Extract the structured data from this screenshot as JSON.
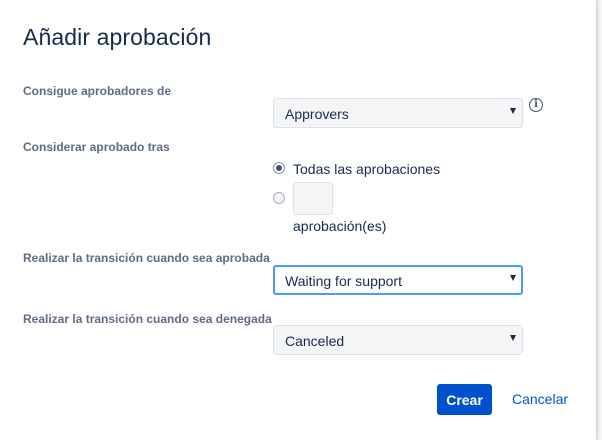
{
  "dialog": {
    "title": "Añadir aprobación"
  },
  "fields": {
    "approvers_from": {
      "label": "Consigue aprobadores de",
      "value": "Approvers"
    },
    "approved_after": {
      "label": "Considerar aprobado tras",
      "option_all": "Todas las aprobaciones",
      "option_count_value": "",
      "option_count_suffix": "aprobación(es)"
    },
    "on_approved": {
      "label": "Realizar la transición cuando sea aprobada",
      "value": "Waiting for support"
    },
    "on_denied": {
      "label": "Realizar la transición cuando sea denegada",
      "value": "Canceled"
    }
  },
  "icons": {
    "info": "i"
  },
  "actions": {
    "create": "Crear",
    "cancel": "Cancelar"
  },
  "colors": {
    "primary": "#0052cc",
    "focus_border": "#4c9aff",
    "heading": "#172b4d",
    "label": "#5e6c84"
  }
}
